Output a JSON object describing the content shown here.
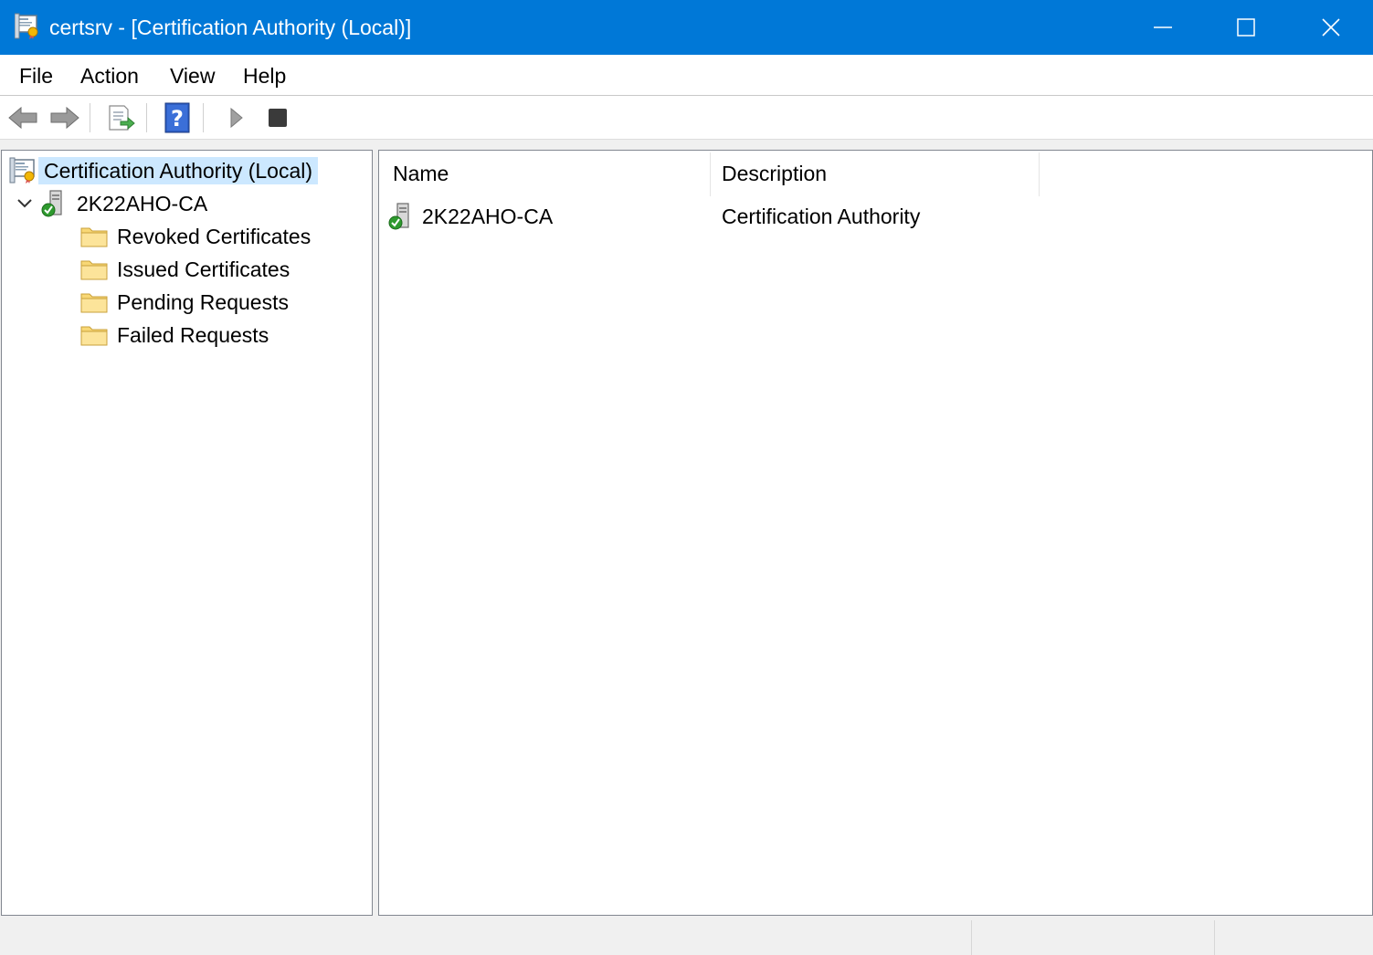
{
  "window": {
    "title": "certsrv - [Certification Authority (Local)]",
    "accent_color": "#0078d7",
    "controls": [
      "minimize-icon",
      "maximize-icon",
      "close-icon"
    ]
  },
  "menu": {
    "items": [
      "File",
      "Action",
      "View",
      "Help"
    ]
  },
  "toolbar": {
    "buttons": [
      "back-arrow-icon",
      "forward-arrow-icon",
      "export-list-icon",
      "help-icon",
      "start-service-icon",
      "stop-service-icon"
    ]
  },
  "tree": {
    "root": "Certification Authority (Local)",
    "ca": "2K22AHO-CA",
    "children": [
      "Revoked Certificates",
      "Issued Certificates",
      "Pending Requests",
      "Failed Requests"
    ]
  },
  "list": {
    "columns": [
      "Name",
      "Description"
    ],
    "rows": [
      {
        "name": "2K22AHO-CA",
        "description": "Certification Authority"
      }
    ]
  }
}
